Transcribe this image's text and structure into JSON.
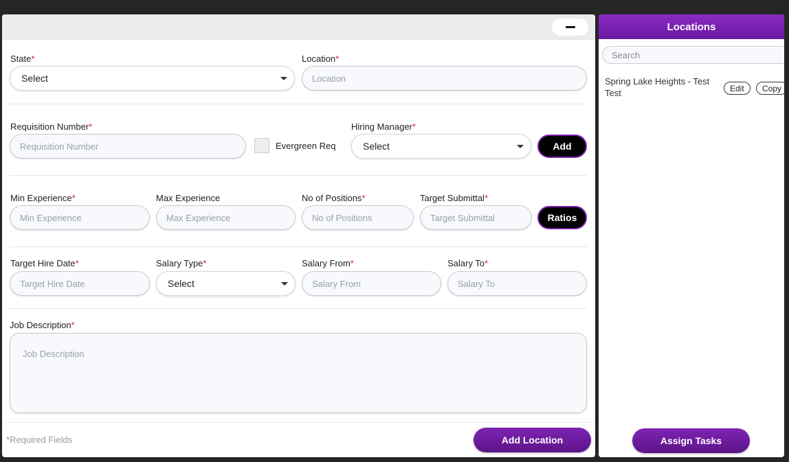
{
  "form": {
    "state": {
      "label": "State",
      "req": "*",
      "value": "Select"
    },
    "location": {
      "label": "Location",
      "req": "*",
      "placeholder": "Location"
    },
    "requisition": {
      "label": "Requisition Number",
      "req": "*",
      "placeholder": "Requisition Number"
    },
    "evergreen": {
      "label": "Evergreen Req"
    },
    "hiring_manager": {
      "label": "Hiring Manager",
      "req": "*",
      "value": "Select"
    },
    "add_button": "Add",
    "min_exp": {
      "label": "Min Experience",
      "req": "*",
      "placeholder": "Min Experience"
    },
    "max_exp": {
      "label": "Max Experience",
      "placeholder": "Max Experience"
    },
    "positions": {
      "label": "No of Positions",
      "req": "*",
      "placeholder": "No of Positions"
    },
    "target_submittal": {
      "label": "Target Submittal",
      "req": "*",
      "placeholder": "Target Submittal"
    },
    "ratios_button": "Ratios",
    "target_hire": {
      "label": "Target Hire Date",
      "req": "*",
      "placeholder": "Target Hire Date"
    },
    "salary_type": {
      "label": "Salary Type",
      "req": "*",
      "value": "Select"
    },
    "salary_from": {
      "label": "Salary From",
      "req": "*",
      "placeholder": "Salary From"
    },
    "salary_to": {
      "label": "Salary To",
      "req": "*",
      "placeholder": "Salary To"
    },
    "job_desc": {
      "label": "Job Description",
      "req": "*",
      "placeholder": "Job Description"
    },
    "required_note": "*Required Fields",
    "add_location_button": "Add Location"
  },
  "locations_panel": {
    "title": "Locations",
    "search_placeholder": "Search",
    "items": [
      {
        "name": "Spring Lake Heights - Test Test",
        "edit": "Edit",
        "copy": "Copy"
      }
    ],
    "assign_button": "Assign Tasks"
  },
  "colors": {
    "accent": "#7a1fae",
    "required": "#e01b1b"
  }
}
